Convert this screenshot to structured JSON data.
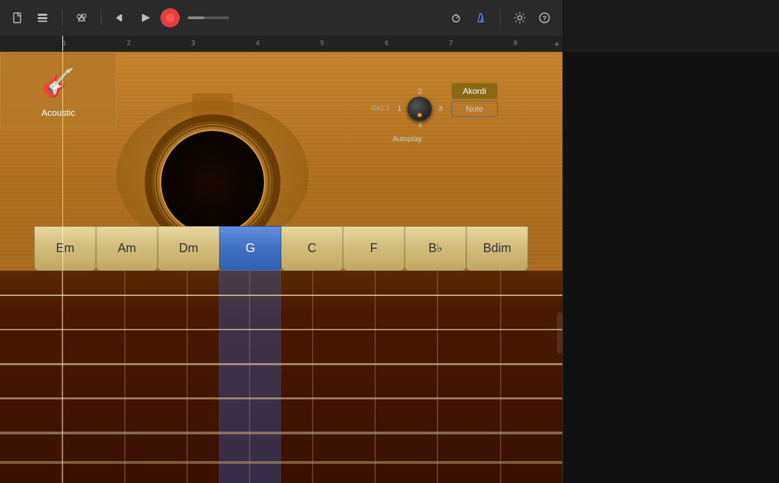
{
  "toolbar": {
    "buttons": [
      "new-file",
      "tracks-view",
      "mixer",
      "rewind",
      "play",
      "record",
      "volume",
      "tuner",
      "metronome",
      "settings",
      "help"
    ],
    "play_label": "▶",
    "rewind_label": "⏮",
    "record_color": "#e04040",
    "volume_level": 40
  },
  "ruler": {
    "marks": [
      "1",
      "2",
      "3",
      "4",
      "5",
      "6",
      "7",
      "8"
    ],
    "plus_label": "+"
  },
  "instrument": {
    "name": "Acoustic",
    "icon": "🎸"
  },
  "autoplay": {
    "label": "Autoplay",
    "positions": [
      "1",
      "2",
      "3",
      "4"
    ],
    "off_label": "ISKLJ."
  },
  "mode_buttons": {
    "akordi_label": "Akordi",
    "note_label": "Note"
  },
  "chords": [
    {
      "label": "Em",
      "active": false
    },
    {
      "label": "Am",
      "active": false
    },
    {
      "label": "Dm",
      "active": false
    },
    {
      "label": "G",
      "active": true
    },
    {
      "label": "C",
      "active": false
    },
    {
      "label": "F",
      "active": false
    },
    {
      "label": "B♭",
      "active": false
    },
    {
      "label": "Bdim",
      "active": false
    }
  ],
  "strings": {
    "count": 6,
    "frets": 9
  }
}
